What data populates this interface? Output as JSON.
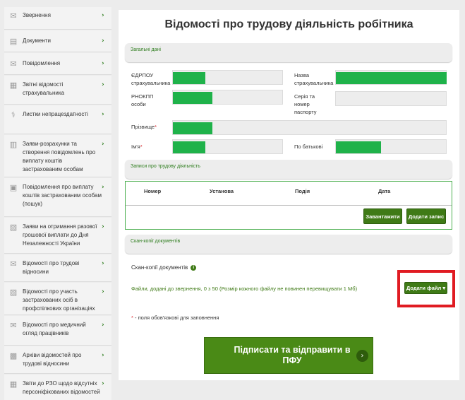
{
  "sidebar": {
    "items": [
      {
        "label": "Звернення",
        "icon": "envelope-icon"
      },
      {
        "label": "Документи",
        "icon": "document-icon"
      },
      {
        "label": "Повідомлення",
        "icon": "envelope-icon"
      },
      {
        "label": "Звітні відомості страхувальника",
        "icon": "report-icon"
      },
      {
        "label": "Листки непрацездатності",
        "icon": "sick-leave-icon"
      },
      {
        "label": "Заяви-розрахунки та створення повідомлень про виплату коштів застрахованим особам",
        "icon": "calculation-icon"
      },
      {
        "label": "Повідомлення про виплату коштів застрахованим особам (пошук)",
        "icon": "search-payment-icon"
      },
      {
        "label": "Заяви на отримання разової грошової виплати до Дня Незалежності України",
        "icon": "application-icon"
      },
      {
        "label": "Відомості про трудові відносини",
        "icon": "envelope-icon"
      },
      {
        "label": "Відомості про участь застрахованих осіб в профспілкових організаціях",
        "icon": "union-icon"
      },
      {
        "label": "Відомості про медичний огляд працівників",
        "icon": "envelope-icon"
      },
      {
        "label": "Архіви відомостей про трудові відносини",
        "icon": "archive-icon"
      },
      {
        "label": "Звіти до РЗО щодо відсутніх персоніфікованих відомостей",
        "icon": "report-icon"
      }
    ],
    "chevron": "›"
  },
  "main": {
    "title": "Відомості про трудову діяльність робітника",
    "general_section": "Загальні дані",
    "fields": {
      "edrpou_label": "ЄДРПОУ страхувальника",
      "insurer_name_label": "Назва страхувальника",
      "rnokpp_label": "РНОКПП особи",
      "passport_label": "Серія та номер паспорту",
      "surname_label": "Прізвище",
      "name_label": "Ім'я",
      "patronymic_label": "По батькові",
      "required_mark": "*"
    },
    "records_section": "Записи про трудову діяльність",
    "table": {
      "columns": [
        "Номер",
        "Установа",
        "Подія",
        "Дата"
      ]
    },
    "buttons": {
      "load": "Завантажити",
      "add_record": "Додати запис",
      "add_file": "Додати файл",
      "add_file_caret": "▾"
    },
    "scans_section": "Скан-копії документів",
    "scans_label": "Скан-копії документів",
    "info_glyph": "i",
    "files_note": "Файли, додані до звернення, 0 з 50 (Розмір кожного файлу не повинен перевищувати 1 Мб)",
    "required_note_mark": "*",
    "required_note": " - поля обов'язкові для заповнення",
    "submit": {
      "label": "Підписати та відправити в ПФУ",
      "arrow": "›"
    }
  },
  "colors": {
    "accent_green": "#3f7a16",
    "field_fill_green": "#1fb24a",
    "highlight_red": "#e01b22",
    "required_red": "#d9262b"
  }
}
